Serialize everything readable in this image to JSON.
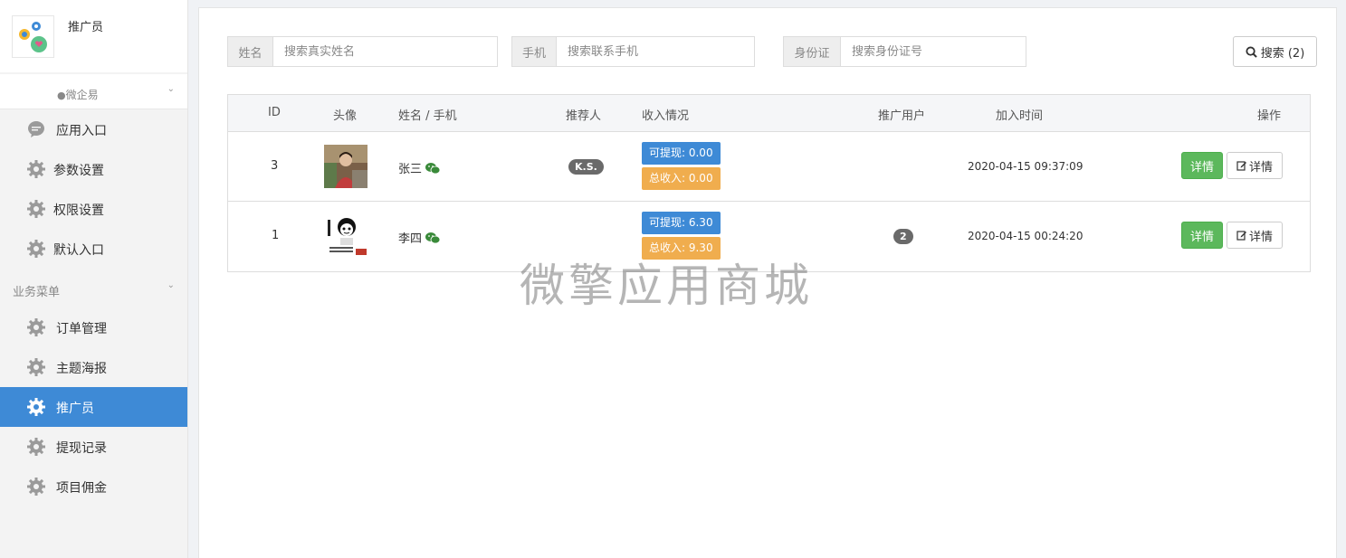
{
  "sidebar": {
    "brand_title": "推广员",
    "group_wq": "微企易",
    "top_items": [
      {
        "label": "应用入口",
        "icon": "chat-bubble-icon"
      },
      {
        "label": "参数设置",
        "icon": "gear-icon"
      },
      {
        "label": "权限设置",
        "icon": "gear-icon"
      },
      {
        "label": "默认入口",
        "icon": "gear-icon"
      }
    ],
    "group_biz": "业务菜单",
    "biz_items": [
      {
        "label": "订单管理",
        "icon": "gear-icon"
      },
      {
        "label": "主题海报",
        "icon": "gear-icon"
      },
      {
        "label": "推广员",
        "icon": "gear-icon",
        "active": true
      },
      {
        "label": "提现记录",
        "icon": "gear-icon"
      },
      {
        "label": "项目佣金",
        "icon": "gear-icon"
      }
    ],
    "active_color": "#3e8ad6"
  },
  "search": {
    "name_addon": "姓名",
    "name_placeholder": "搜索真实姓名",
    "phone_addon": "手机",
    "phone_placeholder": "搜索联系手机",
    "id_addon": "身份证",
    "id_placeholder": "搜索身份证号",
    "button_label": "搜索 (2)"
  },
  "table": {
    "headers": {
      "id": "ID",
      "avatar": "头像",
      "name_phone": "姓名 / 手机",
      "referrer": "推荐人",
      "income": "收入情况",
      "promoted_users": "推广用户",
      "join_time": "加入时间",
      "actions": "操作"
    },
    "rows": [
      {
        "id": "3",
        "name": "张三",
        "referrer": "K.S.",
        "withdrawable": "可提现: 0.00",
        "total_income": "总收入: 0.00",
        "promoted_users": "",
        "join_time": "2020-04-15 09:37:09",
        "detail_label": "详情",
        "edit_label": "详情"
      },
      {
        "id": "1",
        "name": "李四",
        "referrer": "",
        "withdrawable": "可提现: 6.30",
        "total_income": "总收入: 9.30",
        "promoted_users": "2",
        "join_time": "2020-04-15 00:24:20",
        "detail_label": "详情",
        "edit_label": "详情"
      }
    ]
  },
  "watermark": "微擎应用商城",
  "colors": {
    "blue_tag": "#3e8ad6",
    "orange_tag": "#f0ad4e",
    "green_button": "#5cb85c",
    "wechat_icon": "#3a8a3a"
  }
}
